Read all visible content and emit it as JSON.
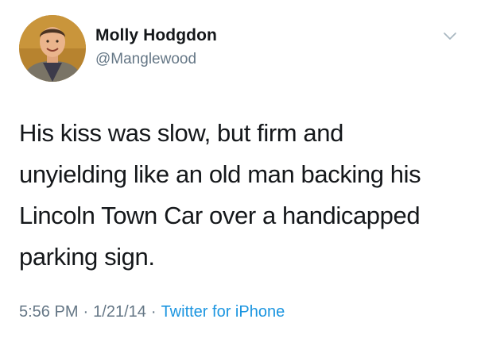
{
  "author": {
    "display_name": "Molly Hodgdon",
    "handle": "@Manglewood",
    "avatar_icon": "profile-photo"
  },
  "tweet": {
    "text_lines": [
      "His kiss was slow, but firm and",
      "unyielding like an old man backing his",
      "Lincoln Town Car over a handicapped",
      "parking sign."
    ]
  },
  "meta": {
    "time": "5:56 PM",
    "date": "1/21/14",
    "separator": "·",
    "source": "Twitter for iPhone"
  },
  "menu_icon": "chevron-down-icon",
  "colors": {
    "text_primary": "#14171a",
    "text_secondary": "#657786",
    "link": "#1b95e0",
    "chevron": "#aab8c2"
  }
}
